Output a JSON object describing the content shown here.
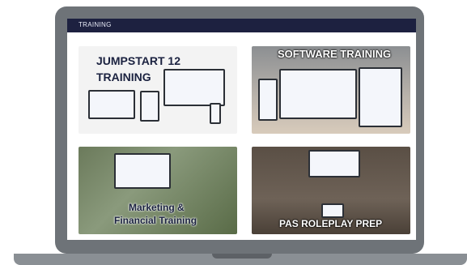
{
  "header": {
    "title": "TRAINING"
  },
  "tiles": [
    {
      "title_line1": "JUMPSTART 12",
      "title_line2": "TRAINING"
    },
    {
      "title": "SOFTWARE TRAINING"
    },
    {
      "title_line1": "Marketing &",
      "title_line2": "Financial Training"
    },
    {
      "title": "PAS ROLEPLAY PREP"
    }
  ],
  "colors": {
    "header_bg": "#1d2140",
    "bezel": "#6e7378",
    "accent_blue": "#1b63c9"
  }
}
